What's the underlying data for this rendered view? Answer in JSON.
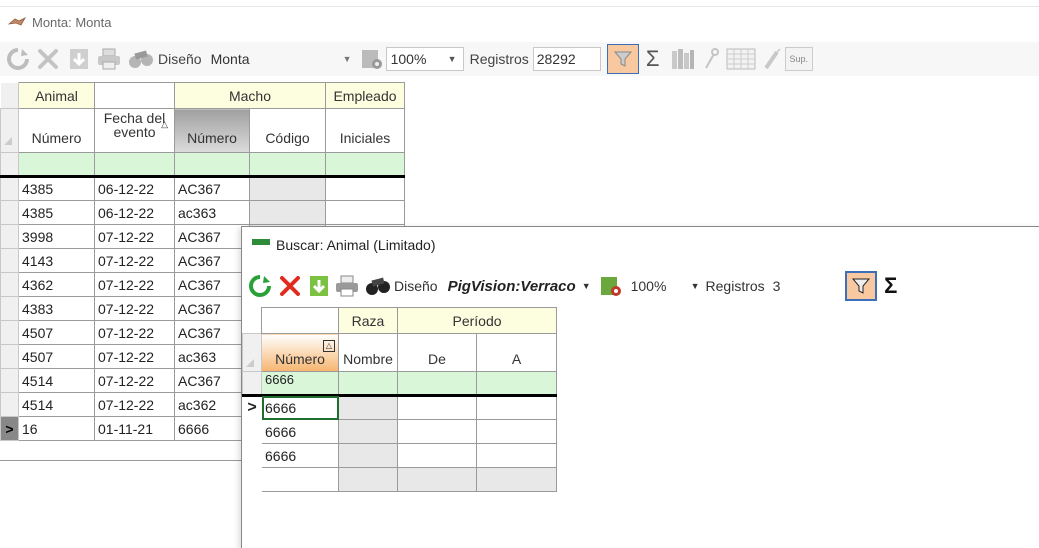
{
  "window": {
    "title": "Monta: Monta"
  },
  "toolbar": {
    "design_label": "Diseño",
    "design_value": "Monta",
    "zoom": "100%",
    "records_label": "Registros",
    "records_value": "28292",
    "sup_label": "Sup."
  },
  "grid1": {
    "groups": [
      "Animal",
      "",
      "Macho",
      "Empleado"
    ],
    "headers": [
      "Número",
      "Fecha del evento",
      "Número",
      "Código",
      "Iniciales"
    ],
    "rows": [
      [
        "4385",
        "06-12-22",
        "AC367",
        ""
      ],
      [
        "4385",
        "06-12-22",
        "ac363",
        ""
      ],
      [
        "3998",
        "07-12-22",
        "AC367",
        ""
      ],
      [
        "4143",
        "07-12-22",
        "AC367",
        ""
      ],
      [
        "4362",
        "07-12-22",
        "AC367",
        ""
      ],
      [
        "4383",
        "07-12-22",
        "AC367",
        ""
      ],
      [
        "4507",
        "07-12-22",
        "AC367",
        ""
      ],
      [
        "4507",
        "07-12-22",
        "ac363",
        ""
      ],
      [
        "4514",
        "07-12-22",
        "AC367",
        ""
      ],
      [
        "4514",
        "07-12-22",
        "ac362",
        ""
      ],
      [
        "16",
        "01-11-21",
        "6666",
        ""
      ]
    ],
    "current_row_marker": ">"
  },
  "popup": {
    "title": "Buscar: Animal (Limitado)",
    "design_label": "Diseño",
    "design_value": "PigVision:Verraco",
    "zoom": "100%",
    "records_label": "Registros",
    "records_value": "3",
    "groups": [
      "",
      "Raza",
      "Período"
    ],
    "headers": [
      "Número",
      "Nombre",
      "De",
      "A"
    ],
    "filter_value": "6666",
    "rows": [
      "6666",
      "6666",
      "6666"
    ],
    "current_row_marker": ">"
  },
  "colors": {
    "filter_active": "#f8c9a0",
    "group_header": "#fdfde0",
    "filter_row": "#d9f6d9"
  }
}
